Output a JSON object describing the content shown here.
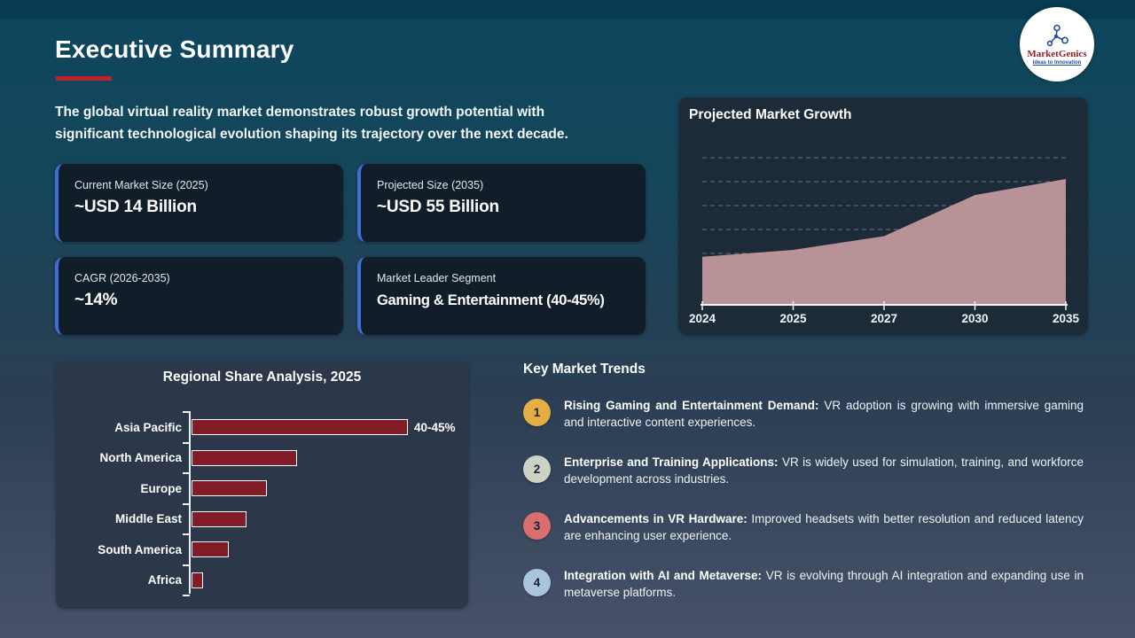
{
  "slide": {
    "title": "Executive Summary",
    "intro_line1": "The global virtual reality market demonstrates robust growth potential with",
    "intro_line2": "significant technological evolution shaping its trajectory over the next decade."
  },
  "logo": {
    "name": "MarketGenics",
    "tagline": "Ideas to Innovation"
  },
  "stat_cards": [
    {
      "label": "Current Market Size (2025)",
      "value": "~USD 14 Billion"
    },
    {
      "label": "Projected Size (2035)",
      "value": "~USD 55 Billion"
    },
    {
      "label": "CAGR (2026-2035)",
      "value": "~14%"
    },
    {
      "label": "Market Leader Segment",
      "value": "Gaming & Entertainment (40-45%)"
    }
  ],
  "trends": {
    "heading": "Key Market Trends",
    "items": [
      {
        "num": "1",
        "color": "#e5ae45",
        "title": "Rising Gaming and Entertainment Demand:",
        "desc": " VR adoption is growing with immersive gaming and interactive content experiences."
      },
      {
        "num": "2",
        "color": "#ccd3c5",
        "title": "Enterprise and Training Applications:",
        "desc": " VR is widely used for simulation, training, and workforce development across industries."
      },
      {
        "num": "3",
        "color": "#d76f6f",
        "title": "Advancements in VR Hardware:",
        "desc": " Improved headsets with better resolution and reduced latency are enhancing user experience."
      },
      {
        "num": "4",
        "color": "#a8c5db",
        "title": "Integration with AI and Metaverse:",
        "desc": " VR is evolving through AI integration and expanding use in metaverse platforms."
      }
    ]
  },
  "chart_data": [
    {
      "type": "area",
      "title": "Projected Market Growth",
      "x": [
        "2024",
        "2025",
        "2027",
        "2030",
        "2035"
      ],
      "values": [
        21,
        24,
        30,
        48,
        55
      ],
      "unit": "USD Billion (estimated from area heights; 2035 = ~55B)",
      "ylim": [
        0,
        85
      ],
      "grid": "horizontal-dashed",
      "legend": "none",
      "fill_color": "#c69ba0"
    },
    {
      "type": "bar",
      "orientation": "horizontal",
      "title": "Regional Share Analysis, 2025",
      "categories": [
        "Asia Pacific",
        "North America",
        "Europe",
        "Middle East",
        "South America",
        "Africa"
      ],
      "values": [
        42.5,
        20.5,
        14.5,
        10.5,
        7,
        2
      ],
      "unit": "% market share (estimated; Asia Pacific labeled 40-45%)",
      "bar_color": "#811c28",
      "annotations": [
        {
          "category": "Asia Pacific",
          "label": "40-45%"
        }
      ],
      "legend": "none"
    }
  ]
}
